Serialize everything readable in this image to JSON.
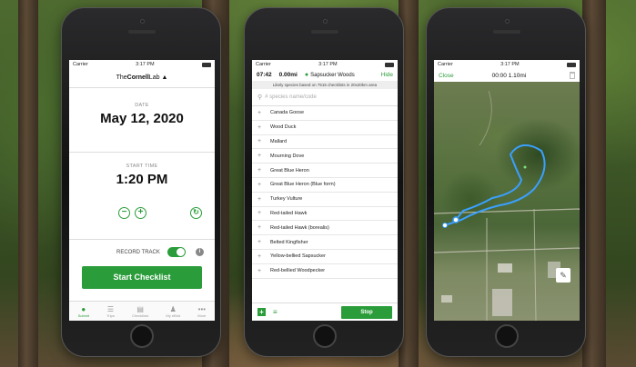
{
  "phone1": {
    "status": {
      "carrier": "Carrier",
      "time": "3:17 PM"
    },
    "logo": {
      "text_a": "The",
      "text_b": "Cornell",
      "text_c": "Lab"
    },
    "date_label": "DATE",
    "date_value": "May 12, 2020",
    "start_label": "START TIME",
    "start_value": "1:20 PM",
    "record_label": "RECORD TRACK",
    "start_button": "Start Checklist",
    "tabs": [
      {
        "label": "Submit",
        "icon": "●"
      },
      {
        "label": "Trips",
        "icon": "☰"
      },
      {
        "label": "Checklists",
        "icon": "▤"
      },
      {
        "label": "My eBird",
        "icon": "♟"
      },
      {
        "label": "More",
        "icon": "•••"
      }
    ]
  },
  "phone2": {
    "status": {
      "carrier": "Carrier",
      "time": "3:17 PM"
    },
    "elapsed": "07:42",
    "distance": "0.00mi",
    "location": "Sapsucker Woods",
    "hide": "Hide",
    "likely_text": "Likely species based on 7515 checklists in 20x20km area",
    "search_placeholder": "# species name/code",
    "species": [
      "Canada Goose",
      "Wood Duck",
      "Mallard",
      "Mourning Dove",
      "Great Blue Heron",
      "Great Blue Heron (Blue form)",
      "Turkey Vulture",
      "Red-tailed Hawk",
      "Red-tailed Hawk (borealis)",
      "Belted Kingfisher",
      "Yellow-bellied Sapsucker",
      "Red-bellied Woodpecker"
    ],
    "stop_button": "Stop"
  },
  "phone3": {
    "status": {
      "carrier": "Carrier",
      "time": "3:17 PM"
    },
    "close": "Close",
    "stats": "00:00  1.10mi"
  }
}
